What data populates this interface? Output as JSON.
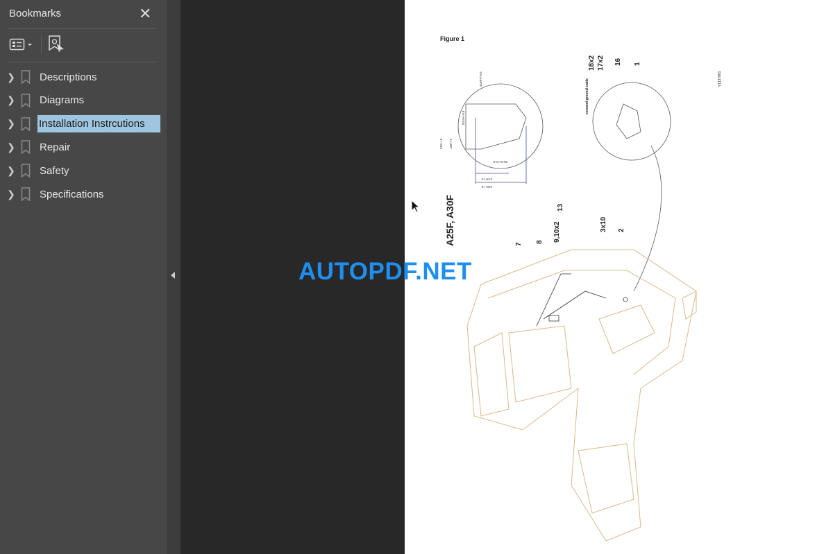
{
  "sidebar": {
    "title": "Bookmarks",
    "close_icon": "close-icon",
    "tools": [
      "bookmark-options-icon",
      "find-current-bookmark-icon"
    ],
    "items": [
      {
        "label": "Descriptions",
        "selected": false
      },
      {
        "label": "Diagrams",
        "selected": false
      },
      {
        "label": "Installation Instrcutions",
        "selected": true
      },
      {
        "label": "Repair",
        "selected": false
      },
      {
        "label": "Safety",
        "selected": false
      },
      {
        "label": "Specifications",
        "selected": false
      }
    ]
  },
  "page": {
    "figure_label": "Figure 1",
    "model_label": "A25F, A30F",
    "drawing_id": "V1137861",
    "callouts": [
      "18x2",
      "17x2",
      "16",
      "1",
      "connect ground cable",
      "13",
      "9,10x2",
      "8",
      "7",
      "3x10",
      "2"
    ],
    "dimensions": [
      "4xø8+/-0.8",
      "83.8+/-0.8",
      "215+/-5",
      "118+/-2",
      "82.8+/-0.5",
      "273+/-2",
      "406+/-5"
    ]
  },
  "watermark": "AUTOPDF.NET",
  "colors": {
    "selection": "#9fc6e0",
    "watermark": "#1e8ff0",
    "drawing_line": "#d9b98a"
  }
}
